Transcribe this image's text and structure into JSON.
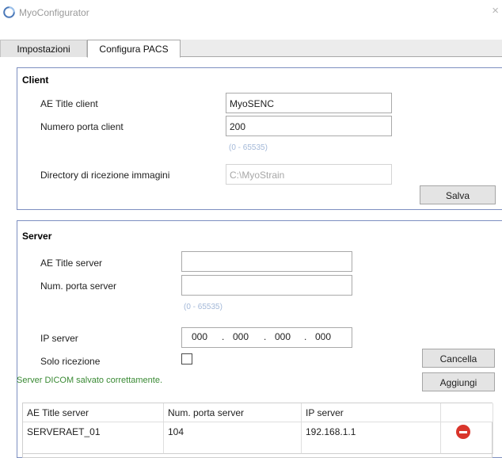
{
  "window": {
    "title": "MyoConfigurator",
    "close_glyph": "×"
  },
  "tabs": [
    {
      "label": "Impostazioni",
      "active": false
    },
    {
      "label": "Configura PACS",
      "active": true
    }
  ],
  "client": {
    "title": "Client",
    "ae_title_label": "AE Title client",
    "ae_title_value": "MyoSENC",
    "port_label": "Numero porta client",
    "port_value": "200",
    "port_hint": "(0 - 65535)",
    "dir_label": "Directory di ricezione immagini",
    "dir_value": "C:\\MyoStrain",
    "save_label": "Salva"
  },
  "server": {
    "title": "Server",
    "ae_title_label": "AE Title server",
    "ae_title_value": "",
    "port_label": "Num. porta server",
    "port_value": "",
    "port_hint": "(0 - 65535)",
    "ip_label": "IP server",
    "ip_segments": [
      "000",
      "000",
      "000",
      "000"
    ],
    "ip_separator": ".",
    "receive_only_label": "Solo ricezione",
    "receive_only_checked": false,
    "cancel_label": "Cancella",
    "add_label": "Aggiungi",
    "status_text": "Server DICOM salvato correttamente.",
    "status_color": "#3a8a34"
  },
  "table": {
    "headers": [
      "AE Title server",
      "Num. porta server",
      "IP server",
      ""
    ],
    "rows": [
      {
        "ae_title": "SERVERAET_01",
        "port": "104",
        "ip": "192.168.1.1",
        "action_icon": "delete-icon"
      }
    ]
  },
  "colors": {
    "group_border": "#7d8fc0",
    "hint": "#a3b8d8",
    "delete": "#d9352b"
  }
}
